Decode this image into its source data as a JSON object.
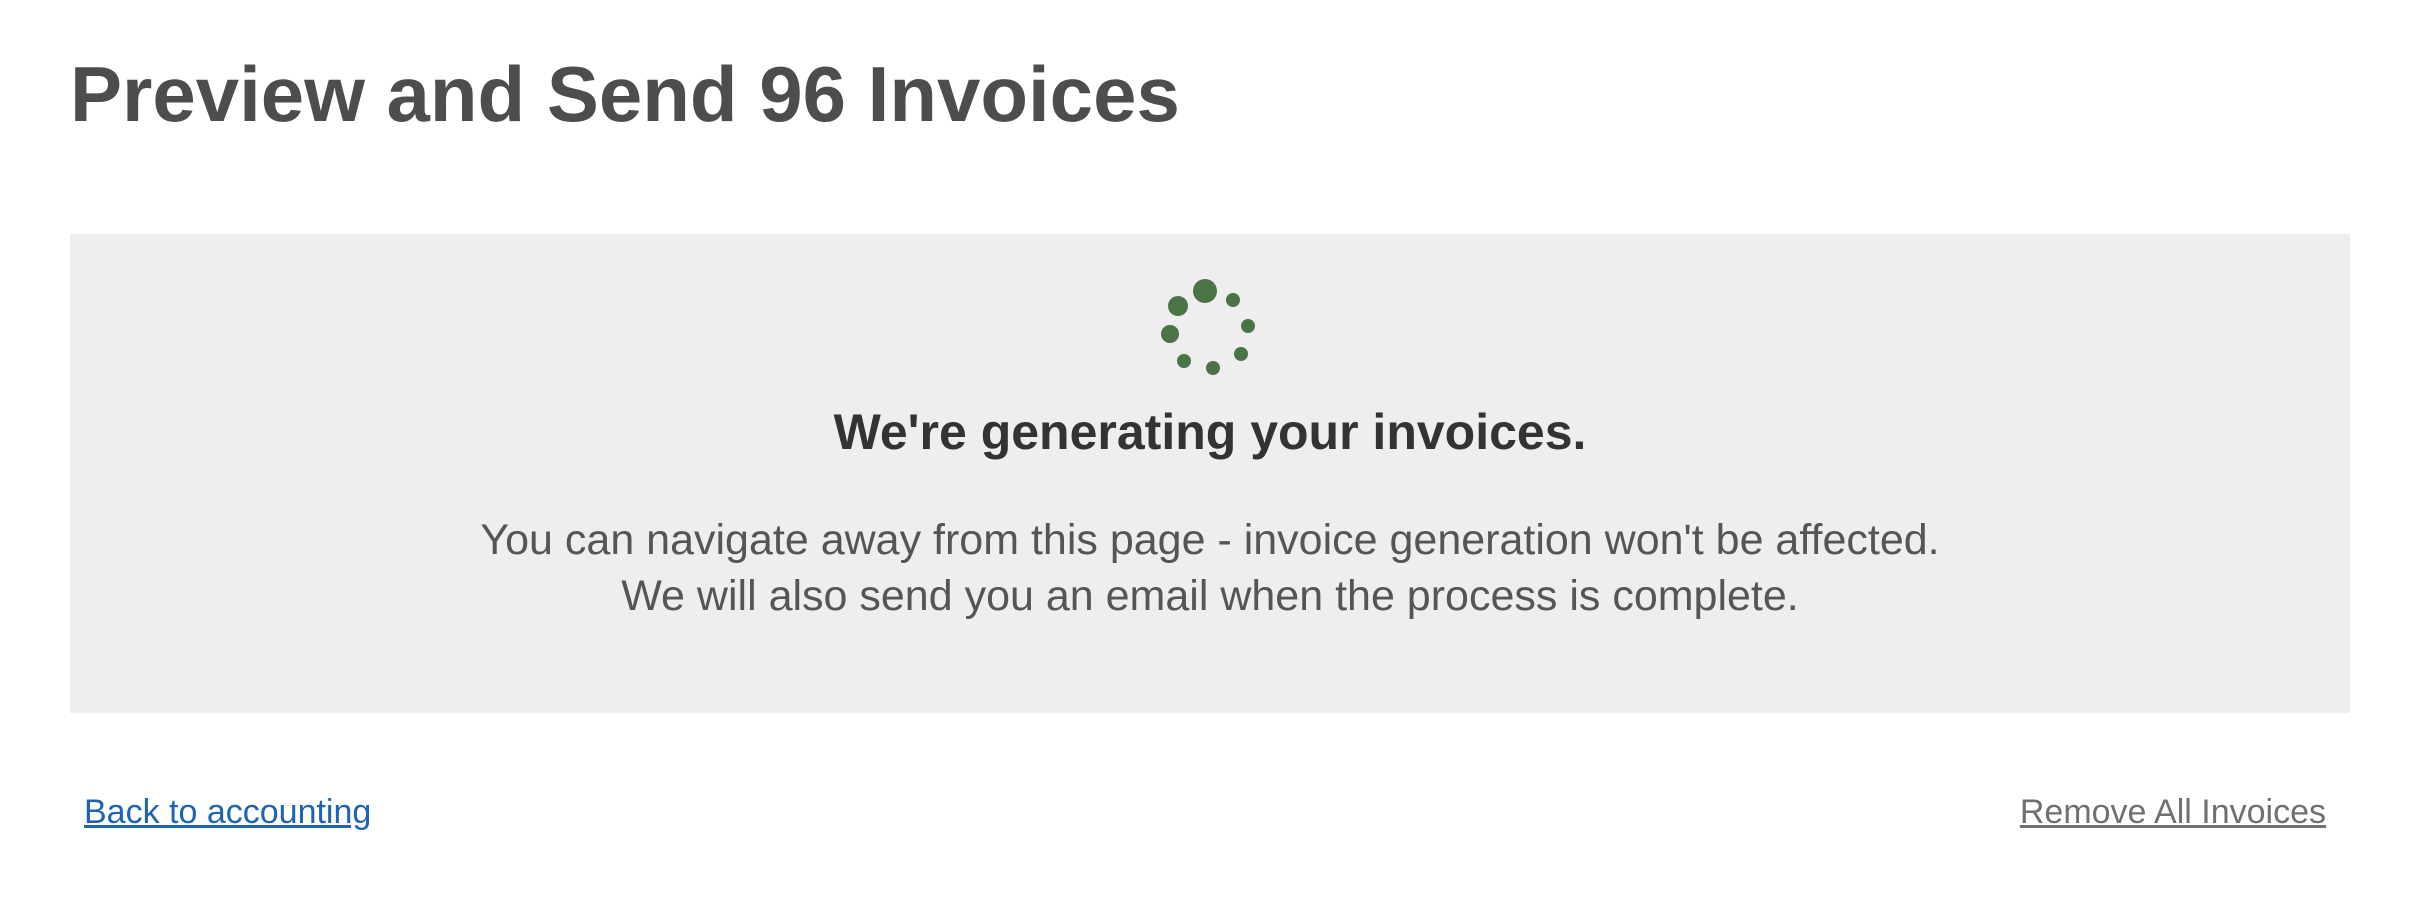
{
  "page": {
    "title": "Preview and Send 96 Invoices"
  },
  "status": {
    "spinner_icon": "loading-spinner-icon",
    "spinner_color": "#4a7445",
    "heading": "We're generating your invoices.",
    "line1": "You can navigate away from this page - invoice generation won't be affected.",
    "line2": "We will also send you an email when the process is complete."
  },
  "footer": {
    "back_label": "Back to accounting",
    "remove_label": "Remove All Invoices",
    "link_color": "#1f63b5"
  }
}
